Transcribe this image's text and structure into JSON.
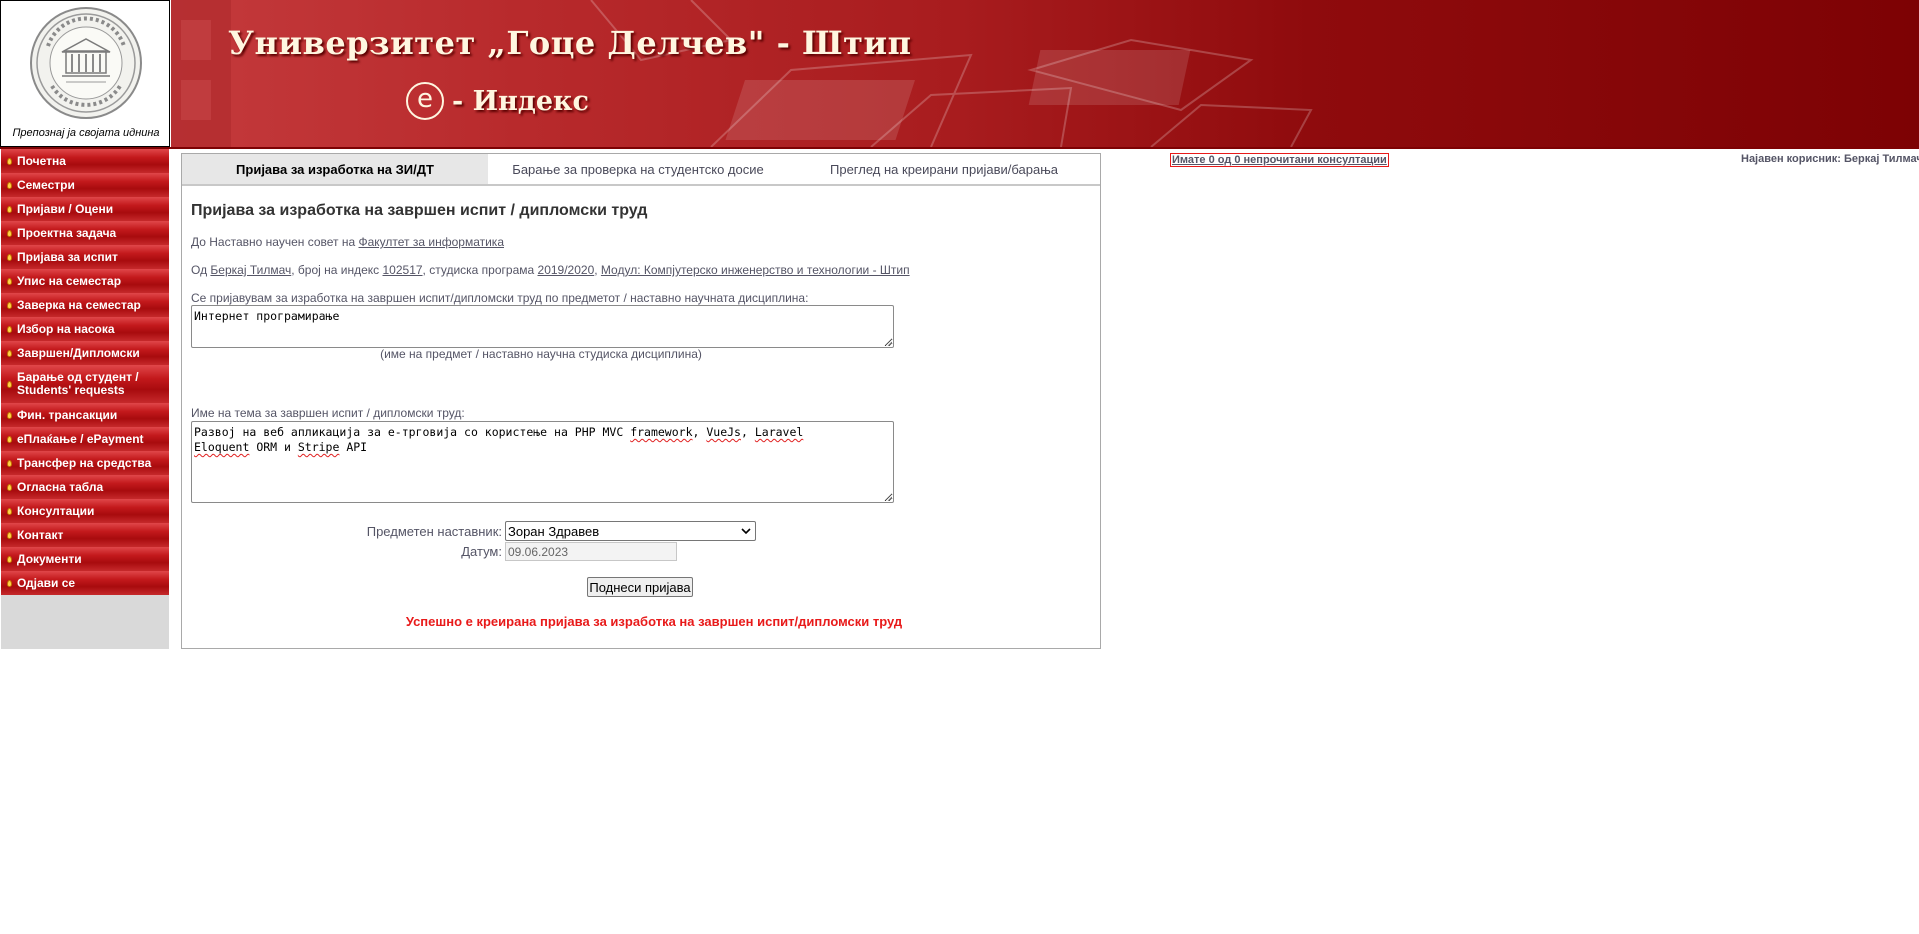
{
  "header": {
    "motto": "Препознај ја својата иднина",
    "university_title": "Универзитет „Гоце Делчев\" - Штип",
    "app_e_letter": "e",
    "app_title": "- Индекс"
  },
  "sidebar": {
    "items": [
      {
        "label": "Почетна"
      },
      {
        "label": "Семестри"
      },
      {
        "label": "Пријави / Оцени"
      },
      {
        "label": "Проектна задача"
      },
      {
        "label": "Пријава за испит"
      },
      {
        "label": "Упис на семестар"
      },
      {
        "label": "Заверка на семестар"
      },
      {
        "label": "Избор на насока"
      },
      {
        "label": "Завршен/Дипломски"
      },
      {
        "label": "Барање од студент / Students' requests"
      },
      {
        "label": "Фин. трансакции"
      },
      {
        "label": "еПлаќање / ePayment"
      },
      {
        "label": "Трансфер на средства"
      },
      {
        "label": "Огласна табла"
      },
      {
        "label": "Консултации"
      },
      {
        "label": "Контакт"
      },
      {
        "label": "Документи"
      },
      {
        "label": "Одјави се"
      }
    ]
  },
  "tabs": [
    {
      "label": "Пријава за изработка на ЗИ/ДТ",
      "active": true
    },
    {
      "label": "Барање за проверка на студентско досие",
      "active": false
    },
    {
      "label": "Преглед на креирани пријави/барања",
      "active": false
    }
  ],
  "form": {
    "title": "Пријава за изработка на завршен испит / дипломски труд",
    "to_prefix": "До Наставно научен совет на ",
    "faculty": "Факултет за информатика",
    "from_prefix": "Од ",
    "student_name": "Беркај Тилмач",
    "index_prefix": ", број на индекс ",
    "index_number": "102517",
    "year_prefix": ", студиска програма ",
    "study_year": "2019/2020",
    "module_sep": ", ",
    "module": "Модул: Компјутерско инженерство и технологии - Штип",
    "subject_label": "Се пријавувам за изработка на завршен испит/дипломски труд по предметот / наставно научната дисциплина:",
    "subject_value": "Интернет програмирање",
    "subject_hint": "(име на предмет / наставно научна студиска дисциплина)",
    "topic_label": "Име на тема за завршен испит / дипломски труд:",
    "topic_value": {
      "p1": "Развој на веб апликација за е-трговија со користење на PHP MVC ",
      "w1": "framework",
      "p2": ", ",
      "w2": "VueJs",
      "p3": ", ",
      "w3": "Laravel",
      "p4": "\n",
      "w4": "Eloquent",
      "p5": " ORM и ",
      "w5": "Stripe",
      "p6": " API"
    },
    "mentor_label": "Предметен наставник:",
    "mentor_value": "Зоран Здравев",
    "date_label": "Датум:",
    "date_value": "09.06.2023",
    "submit_label": "Поднеси пријава",
    "success_message": "Успешно е креирана пријава за изработка на завршен испит/дипломски труд"
  },
  "consultations_notice": "Имате 0 од 0 непрочитани консултации",
  "logged_user": "Најавен корисник: Беркај Тилмач",
  "colors": {
    "accent_red": "#c3191c",
    "success_red": "#e81a1a",
    "link_gray": "#555566"
  }
}
